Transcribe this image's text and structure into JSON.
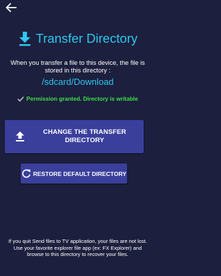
{
  "header": {
    "title": "Transfer Directory"
  },
  "description": "When you transfer a file to this device, the file is stored in this directory :",
  "path": "/sdcard/Download",
  "permission": {
    "text": "Permission granted. Directory is writable"
  },
  "buttons": {
    "change_label": "CHANGE THE TRANSFER DIRECTORY",
    "restore_label": "RESTORE DEFAULT DIRECTORY"
  },
  "footer": {
    "line1": "If you quit Send files to TV application, your files are not lost.",
    "line2": "Use your favorite explorer file app (ex: FX Explorer) and browse to this directory to recover your files."
  },
  "icons": {
    "back": "arrow-back-icon",
    "download": "download-icon",
    "check": "check-icon",
    "upload": "upload-icon",
    "restore": "refresh-icon"
  },
  "colors": {
    "background": "#1c1f3d",
    "accent": "#2ec7f0",
    "success": "#3fe04a",
    "button": "#3a3f9c"
  }
}
